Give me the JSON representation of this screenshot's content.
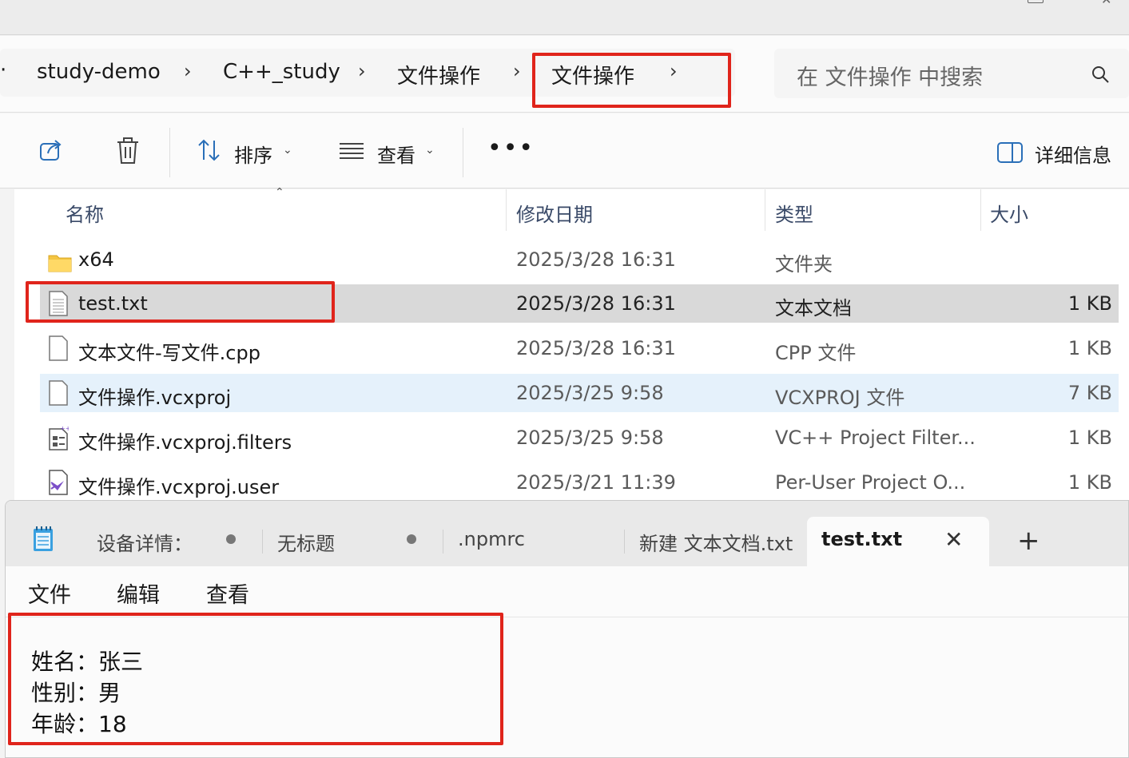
{
  "breadcrumb": {
    "items": [
      "study-demo",
      "C++_study",
      "文件操作",
      "文件操作"
    ]
  },
  "search": {
    "placeholder": "在 文件操作 中搜索"
  },
  "toolbar": {
    "sort_label": "排序",
    "view_label": "查看",
    "details_label": "详细信息"
  },
  "columns": {
    "name": "名称",
    "date": "修改日期",
    "type": "类型",
    "size": "大小"
  },
  "files": [
    {
      "name": "x64",
      "date": "2025/3/28 16:31",
      "type": "文件夹",
      "size": "",
      "icon": "folder-icon"
    },
    {
      "name": "test.txt",
      "date": "2025/3/28 16:31",
      "type": "文本文档",
      "size": "1 KB",
      "icon": "text-file-icon"
    },
    {
      "name": "文本文件-写文件.cpp",
      "date": "2025/3/28 16:31",
      "type": "CPP 文件",
      "size": "1 KB",
      "icon": "blank-file-icon"
    },
    {
      "name": "文件操作.vcxproj",
      "date": "2025/3/25 9:58",
      "type": "VCXPROJ 文件",
      "size": "7 KB",
      "icon": "blank-file-icon"
    },
    {
      "name": "文件操作.vcxproj.filters",
      "date": "2025/3/25 9:58",
      "type": "VC++ Project Filter...",
      "size": "1 KB",
      "icon": "filters-file-icon"
    },
    {
      "name": "文件操作.vcxproj.user",
      "date": "2025/3/21 11:39",
      "type": "Per-User Project O...",
      "size": "1 KB",
      "icon": "vs-user-file-icon"
    }
  ],
  "notepad": {
    "tabs": [
      "设备详情：",
      "无标题",
      ".npmrc",
      "新建 文本文档.txt",
      "test.txt"
    ],
    "menu": [
      "文件",
      "编辑",
      "查看"
    ],
    "content": [
      "姓名：张三",
      "性别：男",
      "年龄：18"
    ]
  },
  "colors": {
    "highlight": "#e0241b",
    "selected_row": "#d9d9d9",
    "hover_row": "#e5f1fb"
  }
}
